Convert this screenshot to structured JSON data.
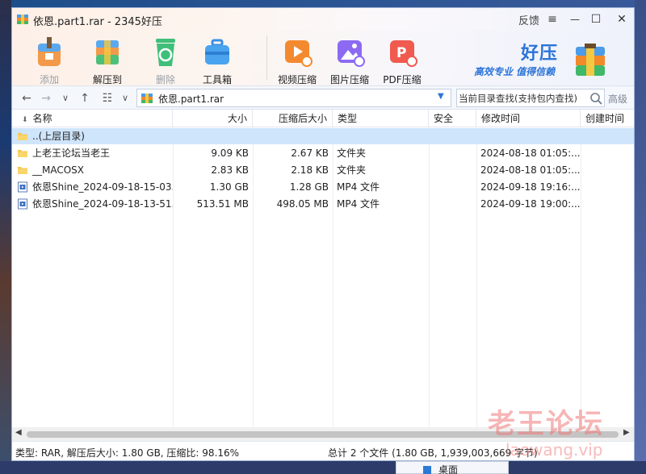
{
  "window": {
    "title": "依恩.part1.rar - 2345好压",
    "feedback_label": "反馈",
    "menu_glyph": "≡",
    "minimize_glyph": "—",
    "maximize_glyph": "☐",
    "close_glyph": "✕"
  },
  "toolbar": {
    "items": [
      {
        "label": "添加",
        "icon": "add-archive-icon",
        "enabled": false
      },
      {
        "label": "解压到",
        "icon": "extract-to-icon",
        "enabled": true
      },
      {
        "label": "删除",
        "icon": "recycle-delete-icon",
        "enabled": false
      },
      {
        "label": "工具箱",
        "icon": "toolbox-icon",
        "enabled": true
      },
      {
        "label": "视频压缩",
        "icon": "video-compress-icon",
        "enabled": true
      },
      {
        "label": "图片压缩",
        "icon": "image-compress-icon",
        "enabled": true
      },
      {
        "label": "PDF压缩",
        "icon": "pdf-compress-icon",
        "enabled": true
      }
    ]
  },
  "brand": {
    "name": "好压",
    "slogan": "高效专业  值得信赖",
    "color": "#2c74d8"
  },
  "navbar": {
    "back_glyph": "←",
    "forward_glyph": "→",
    "down_glyph": "∨",
    "up_glyph": "↑",
    "view_glyph": "☷",
    "path": "依恩.part1.rar",
    "search_placeholder": "当前目录查找(支持包内查找)",
    "advanced_label": "高级"
  },
  "columns": [
    "名称",
    "大小",
    "压缩后大小",
    "类型",
    "安全",
    "修改时间",
    "创建时间"
  ],
  "sort_glyph": "⬇",
  "rows": [
    {
      "name": "..(上层目录)",
      "size": "",
      "packed": "",
      "type": "",
      "security": "",
      "modified": "",
      "created": "",
      "icon": "folder-icon",
      "selected": true
    },
    {
      "name": "上老王论坛当老王",
      "size": "9.09 KB",
      "packed": "2.67 KB",
      "type": "文件夹",
      "security": "",
      "modified": "2024-08-18 01:05:...",
      "created": "",
      "icon": "folder-icon",
      "selected": false
    },
    {
      "name": "__MACOSX",
      "size": "2.83 KB",
      "packed": "2.18 KB",
      "type": "文件夹",
      "security": "",
      "modified": "2024-08-18 01:05:...",
      "created": "",
      "icon": "folder-icon",
      "selected": false
    },
    {
      "name": "依恩Shine_2024-09-18-15-03...",
      "size": "1.30 GB",
      "packed": "1.28 GB",
      "type": "MP4 文件",
      "security": "",
      "modified": "2024-09-18 19:16:...",
      "created": "",
      "icon": "video-file-icon",
      "selected": false
    },
    {
      "name": "依恩Shine_2024-09-18-13-51...",
      "size": "513.51 MB",
      "packed": "498.05 MB",
      "type": "MP4 文件",
      "security": "",
      "modified": "2024-09-18 19:00:...",
      "created": "",
      "icon": "video-file-icon",
      "selected": false
    }
  ],
  "status": {
    "left": "类型: RAR, 解压后大小: 1.80 GB, 压缩比: 98.16%",
    "right": "总计 2 个文件 (1.80 GB, 1,939,003,669 字节)"
  },
  "watermark": {
    "line1": "老王论坛",
    "line2": "laowang.vip"
  },
  "desktop": {
    "tooltip": "桌面"
  }
}
